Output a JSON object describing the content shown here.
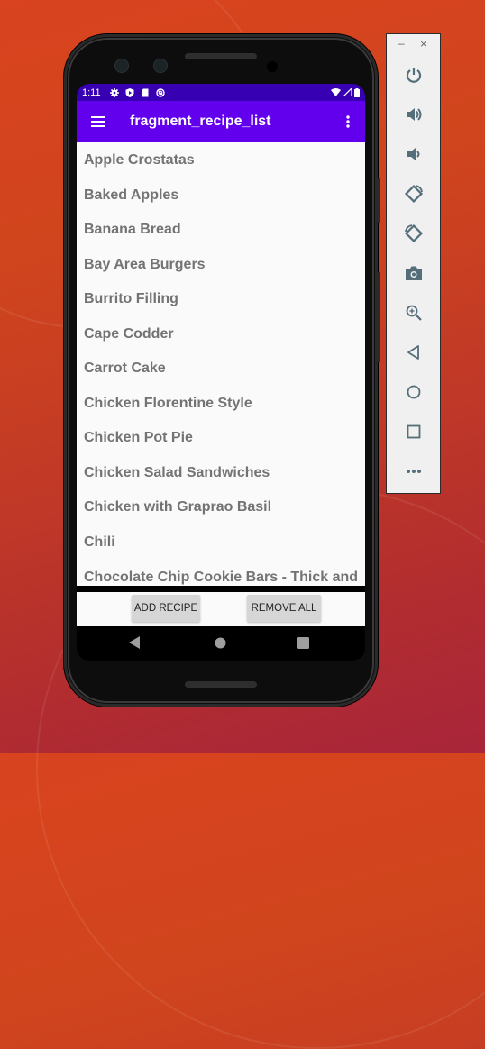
{
  "status_bar": {
    "time": "1:11",
    "left_icons": [
      "settings-icon",
      "shield-play-icon",
      "sd-card-icon",
      "data-saver-icon"
    ],
    "right_icons": [
      "wifi-icon",
      "cell-signal-icon",
      "battery-icon"
    ]
  },
  "app_bar": {
    "title": "fragment_recipe_list",
    "menu_icon": "hamburger-menu-icon",
    "overflow_icon": "more-vert-icon"
  },
  "recipes": [
    "Apple Crostatas",
    "Baked Apples",
    "Banana Bread",
    "Bay Area Burgers",
    "Burrito Filling",
    "Cape Codder",
    "Carrot Cake",
    "Chicken Florentine Style",
    "Chicken Pot Pie",
    "Chicken Salad Sandwiches",
    "Chicken with Graprao Basil",
    "Chili",
    "Chocolate Chip Cookie Bars - Thick and Chewy"
  ],
  "actions": {
    "add_label": "ADD RECIPE",
    "remove_label": "REMOVE ALL"
  },
  "nav_bar": {
    "back": "back-triangle-icon",
    "home": "home-circle-icon",
    "recents": "recents-square-icon"
  },
  "emulator_toolbar": {
    "minimize": "–",
    "close": "×",
    "buttons": [
      "power",
      "volume-up",
      "volume-down",
      "rotate-left",
      "rotate-right",
      "screenshot",
      "zoom",
      "back",
      "home",
      "overview",
      "more"
    ]
  },
  "colors": {
    "status_bar": "#3700b3",
    "app_bar": "#6200ee",
    "list_bg": "#fafafa",
    "list_text": "#737373",
    "button_bg": "#d6d6d6",
    "toolbar_icon": "#546e7a"
  }
}
